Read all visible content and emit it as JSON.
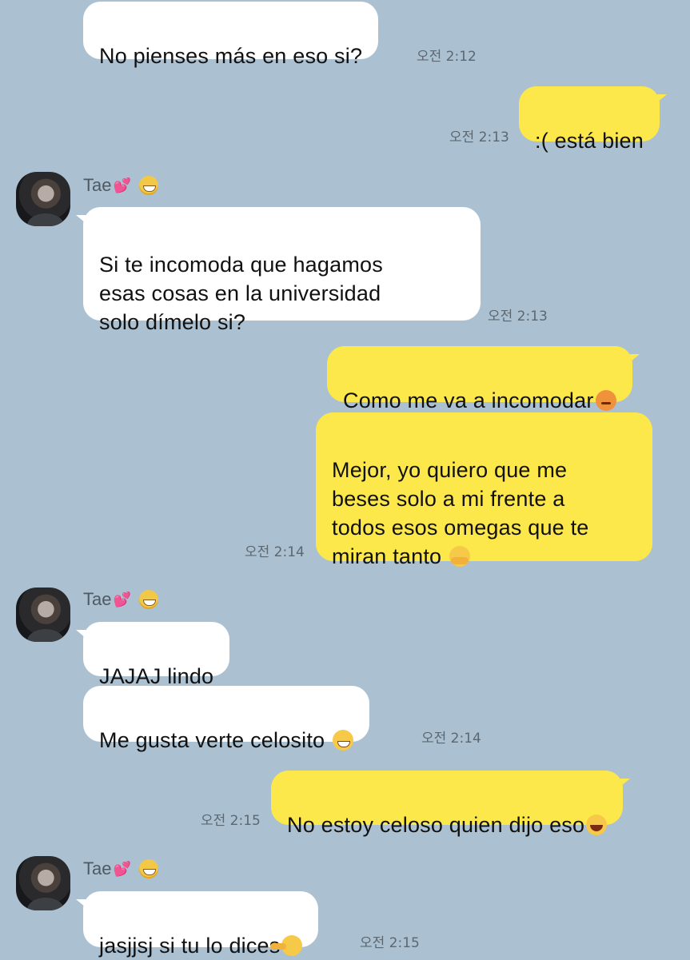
{
  "contact": {
    "name": "Tae",
    "name_heart": "💕",
    "name_emoji": "grinning-face"
  },
  "messages": [
    {
      "id": "m1",
      "side": "in",
      "text": "No pienses más en eso si?",
      "time": "오전 2:12"
    },
    {
      "id": "m2",
      "side": "out",
      "text": ":( está bien",
      "time": "오전 2:13"
    },
    {
      "id": "m3",
      "side": "in",
      "text": "Si te incomoda que hagamos\nesas cosas en la universidad\nsolo dímelo si?",
      "time": "오전 2:13"
    },
    {
      "id": "m4",
      "side": "out",
      "text": "Como me va a incomodar",
      "emoji": "angry-face"
    },
    {
      "id": "m5",
      "side": "out",
      "text": "Mejor, yo quiero que me\nbeses solo a mi frente a\ntodos esos omegas que te\nmiran tanto",
      "emoji": "hugging-face",
      "time": "오전 2:14"
    },
    {
      "id": "m6",
      "side": "in",
      "text": "JAJAJ lindo"
    },
    {
      "id": "m7",
      "side": "in",
      "text": "Me gusta verte celosito",
      "emoji": "grinning-face",
      "time": "오전 2:14"
    },
    {
      "id": "m8",
      "side": "out",
      "text": "No estoy celoso quien dijo eso",
      "emoji": "laughing-face",
      "time": "오전 2:15"
    },
    {
      "id": "m9",
      "side": "in",
      "text": "jasjjsj si tu lo dices",
      "emoji": "pointing-hand-wink",
      "time": "오전 2:15"
    }
  ],
  "colors": {
    "background": "#abc1d1",
    "incoming_bubble": "#ffffff",
    "outgoing_bubble": "#fde84b"
  }
}
